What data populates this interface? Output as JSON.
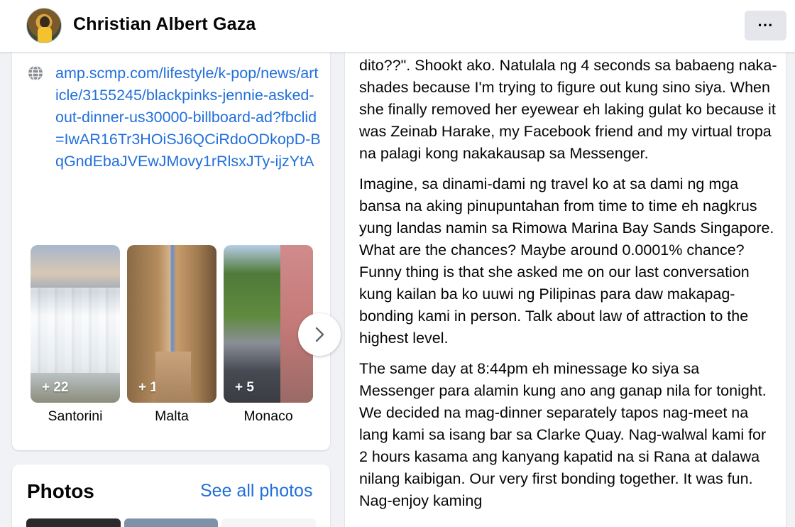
{
  "header": {
    "profile_name": "Christian Albert Gaza",
    "more_label": "···"
  },
  "link": {
    "url": "amp.scmp.com/lifestyle/k-pop/news/article/3155245/blackpinks-jennie-asked-out-dinner-us30000-billboard-ad?fbclid=IwAR16Tr3HOiSJ6QCiRdoODkopD-BqGndEbaJVEwJMovy1rRlsxJTy-ijzYtA"
  },
  "albums": [
    {
      "name": "Santorini",
      "count": "+ 22"
    },
    {
      "name": "Malta",
      "count": "+ 11"
    },
    {
      "name": "Monaco",
      "count": "+ 5"
    }
  ],
  "photos": {
    "title": "Photos",
    "see_all": "See all photos"
  },
  "post": {
    "paragraphs": [
      "dito??\". Shookt ako. Natulala ng 4 seconds sa babaeng naka-shades because I'm trying to figure out kung sino siya. When she finally removed her eyewear eh laking gulat ko because it was Zeinab Harake, my Facebook friend and my virtual tropa na palagi kong nakakausap sa Messenger.",
      "Imagine, sa dinami-dami ng travel ko at sa dami ng mga bansa na aking pinupuntahan from time to time eh nagkrus yung landas namin sa Rimowa Marina Bay Sands Singapore. What are the chances? Maybe around 0.0001% chance? Funny thing is that she asked me on our last conversation kung kailan ba ko uuwi ng Pilipinas para daw makapag-bonding kami in person. Talk about law of attraction to the highest level.",
      "The same day at 8:44pm eh minessage ko siya sa Messenger para alamin kung ano ang ganap nila for tonight. We decided na mag-dinner separately tapos nag-meet na lang kami sa isang bar sa Clarke Quay. Nag-walwal kami for 2 hours kasama ang kanyang kapatid na si Rana at dalawa nilang kaibigan. Our very first bonding together. It was fun. Nag-enjoy kaming"
    ]
  }
}
